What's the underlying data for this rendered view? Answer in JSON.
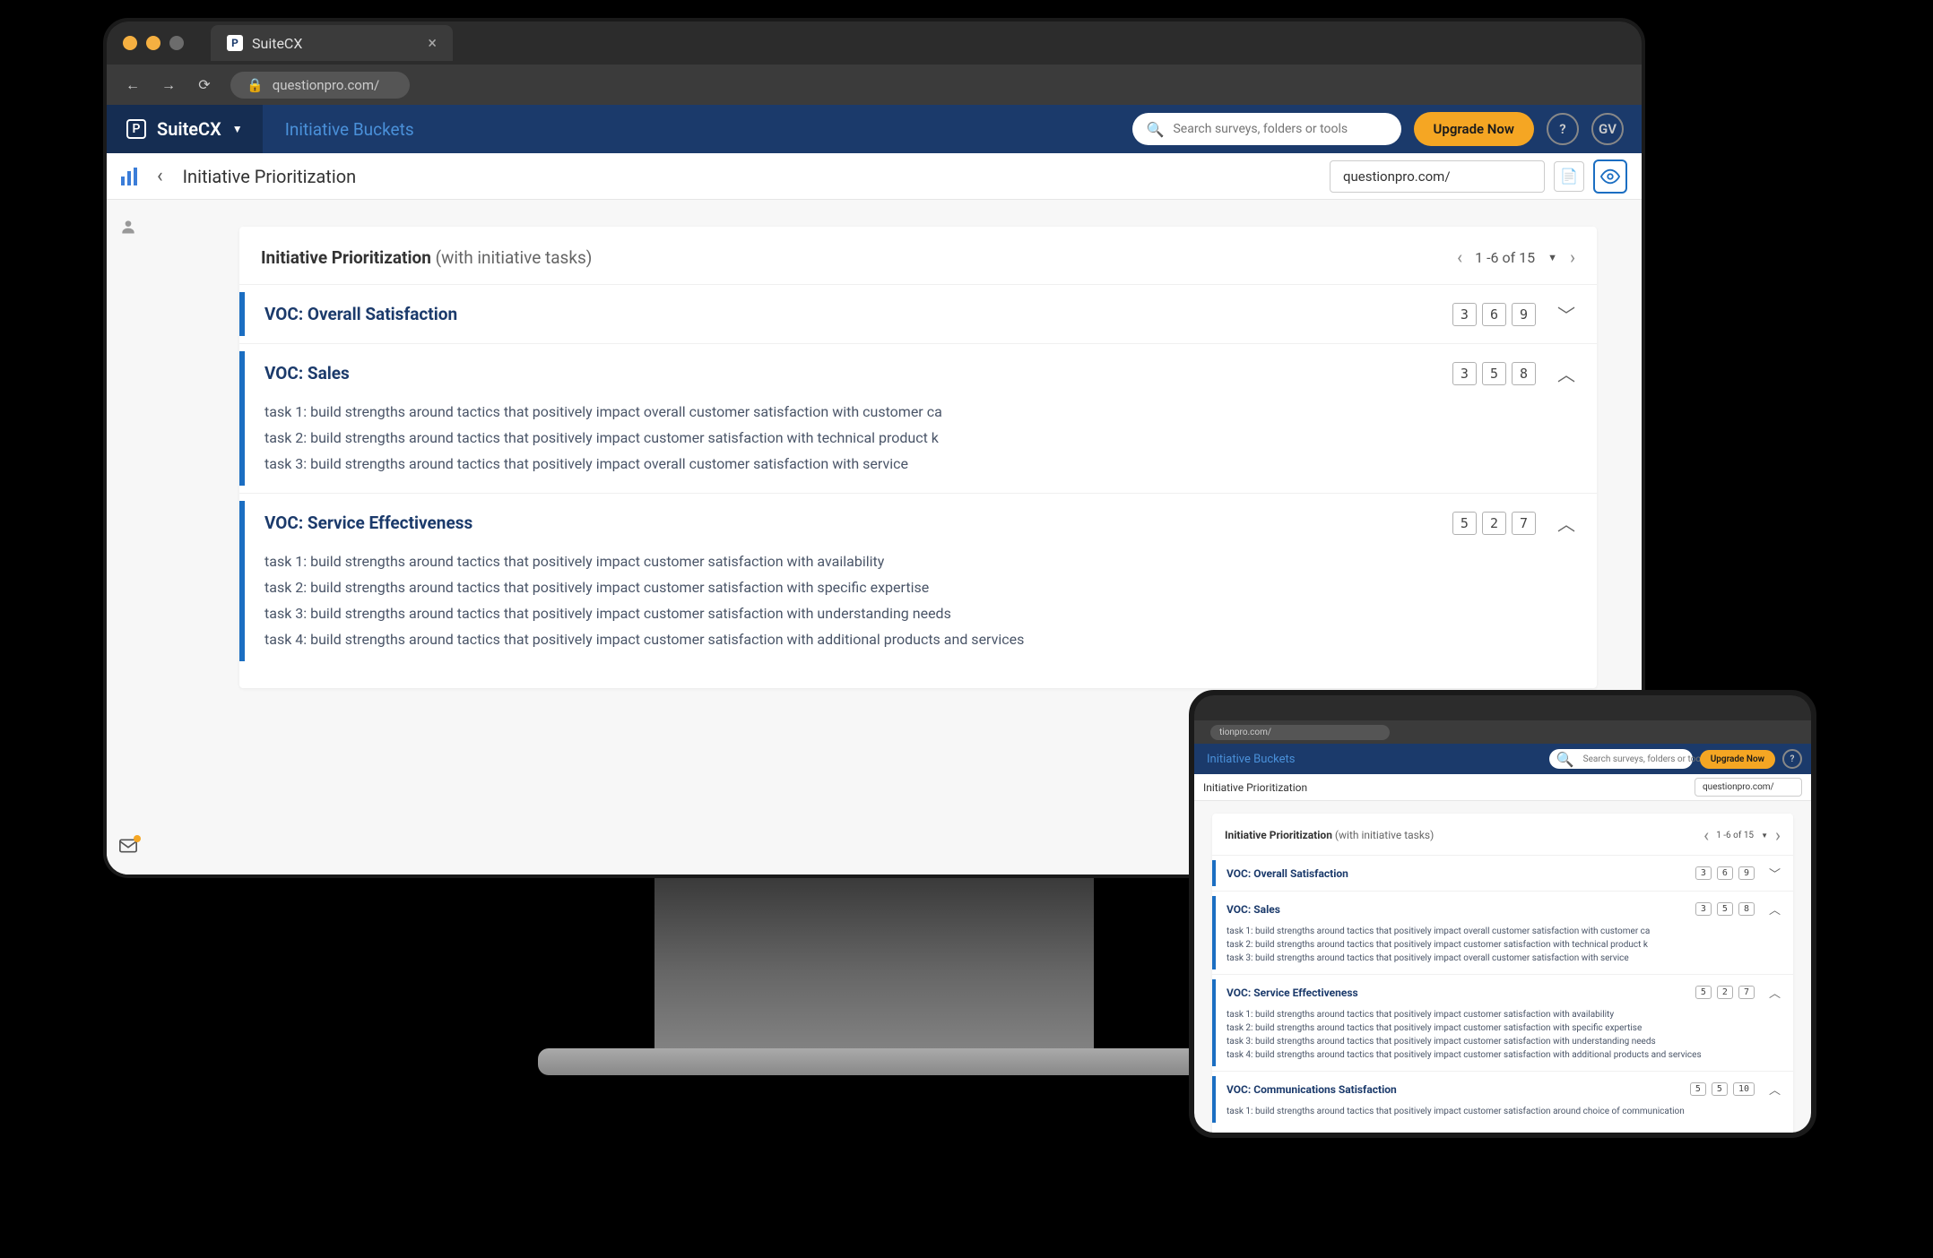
{
  "browser": {
    "tab_title": "SuiteCX",
    "url": "questionpro.com/"
  },
  "header": {
    "brand": "SuiteCX",
    "breadcrumb": "Initiative Buckets",
    "search_placeholder": "Search surveys, folders or tools",
    "upgrade_label": "Upgrade Now",
    "help_label": "?",
    "avatar_label": "GV"
  },
  "subnav": {
    "page_title": "Initiative Prioritization",
    "url_display": "questionpro.com/"
  },
  "panel": {
    "title_bold": "Initiative Prioritization",
    "title_rest": " (with initiative tasks)",
    "pager": "1 -6 of 15"
  },
  "initiatives": [
    {
      "title": "VOC: Overall Satisfaction",
      "scores": [
        "3",
        "6",
        "9"
      ],
      "expanded": false,
      "tasks": []
    },
    {
      "title": "VOC: Sales",
      "scores": [
        "3",
        "5",
        "8"
      ],
      "expanded": true,
      "tasks": [
        "task 1: build strengths around tactics that positively impact overall customer satisfaction with customer ca",
        "task 2: build strengths around tactics that positively impact customer satisfaction with technical product k",
        "task 3: build strengths around tactics that positively impact overall customer satisfaction with service"
      ]
    },
    {
      "title": "VOC: Service Effectiveness",
      "scores": [
        "5",
        "2",
        "7"
      ],
      "expanded": true,
      "tasks": [
        "task 1: build strengths around tactics that positively impact customer satisfaction with availability",
        "task 2: build strengths around tactics that positively impact customer satisfaction with specific expertise",
        "task 3: build strengths around tactics that positively impact customer satisfaction with understanding needs",
        "task 4: build strengths around tactics that positively impact customer satisfaction with additional products and services"
      ]
    },
    {
      "title": "VOC: Communications Satisfaction",
      "scores": [
        "5",
        "5",
        "10"
      ],
      "expanded": true,
      "tasks": [
        "task 1: build strengths around tactics that positively impact customer satisfaction around choice of communication"
      ]
    }
  ],
  "tablet_url": "tionpro.com/"
}
